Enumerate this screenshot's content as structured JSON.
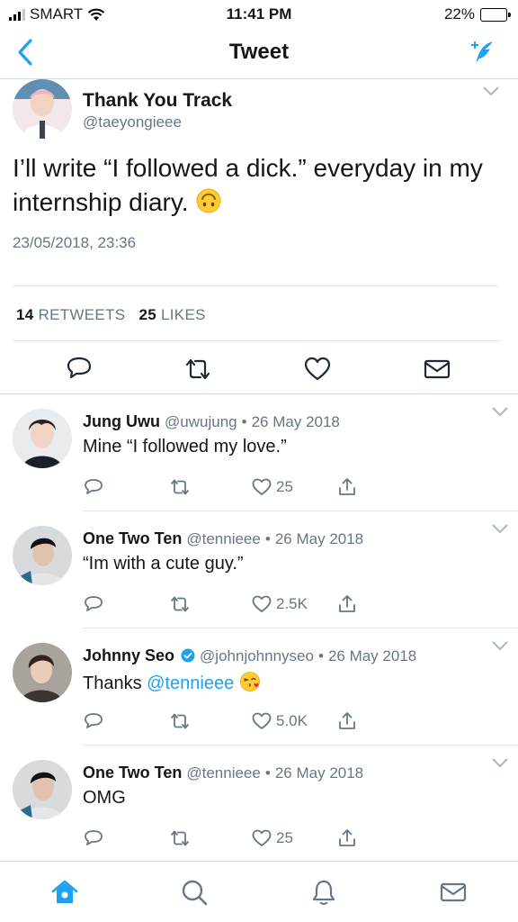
{
  "status": {
    "carrier": "SMART",
    "time": "11:41 PM",
    "battery": "22%",
    "battery_level": 0.22,
    "battery_color": "#fecb0b"
  },
  "nav": {
    "title": "Tweet",
    "back_icon": "chevron-left-icon",
    "compose_icon": "compose-icon",
    "accent": "#1da1f2"
  },
  "main_tweet": {
    "name": "Thank You Track",
    "handle": "@taeyongieee",
    "text": "I’ll write “I followed a dick.” everyday in my internship diary.",
    "emoji": "upside-down-face-emoji",
    "timestamp": "23/05/2018, 23:36",
    "retweets_count": "14",
    "retweets_label": "RETWEETS",
    "likes_count": "25",
    "likes_label": "LIKES"
  },
  "replies": [
    {
      "name": "Jung Uwu",
      "handle": "@uwujung",
      "date": "26 May 2018",
      "text": "Mine “I followed my love.”",
      "likes": "25",
      "verified": false
    },
    {
      "name": "One Two Ten",
      "handle": "@tennieee",
      "date": "26 May 2018",
      "text": "“Im with a cute guy.”",
      "likes": "2.5K",
      "verified": false
    },
    {
      "name": "Johnny Seo",
      "handle": "@johnjohnnyseo",
      "date": "26 May 2018",
      "text_prefix": "Thanks ",
      "mention": "@tennieee",
      "emoji": "face-blowing-kiss-emoji",
      "likes": "5.0K",
      "verified": true
    },
    {
      "name": "One Two Ten",
      "handle": "@tennieee",
      "date": "26 May 2018",
      "text": "OMG",
      "likes": "25",
      "verified": false
    }
  ],
  "separator": "•",
  "tabbar": {
    "items": [
      "home-icon",
      "search-icon",
      "notifications-icon",
      "messages-icon"
    ],
    "active": "home-icon"
  }
}
